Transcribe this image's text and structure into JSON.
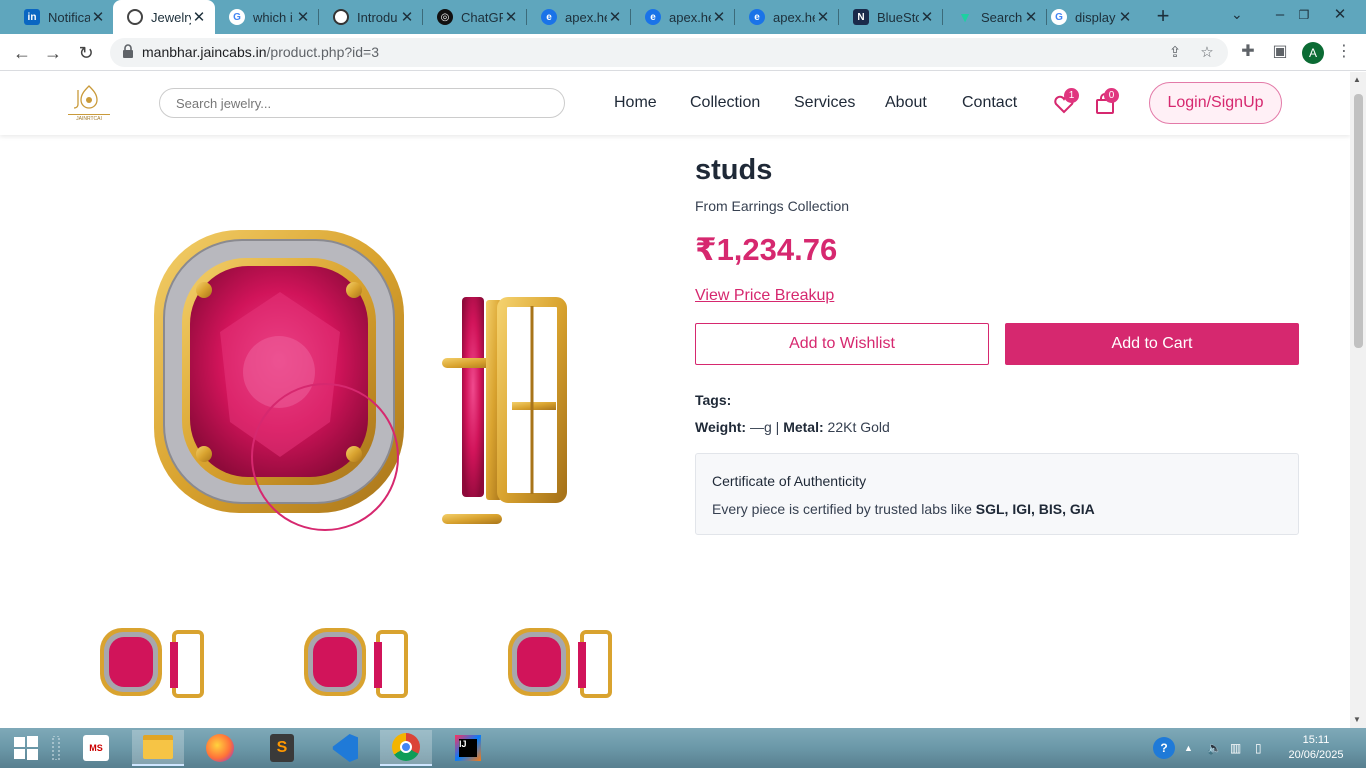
{
  "browser": {
    "tabs": [
      {
        "label": "Notifica",
        "icon": "linkedin-icon"
      },
      {
        "label": "Jewelry",
        "icon": "globe-icon",
        "active": true
      },
      {
        "label": "which i",
        "icon": "google-icon"
      },
      {
        "label": "Introdu",
        "icon": "openai-icon"
      },
      {
        "label": "ChatGP",
        "icon": "openai-icon"
      },
      {
        "label": "apex.he",
        "icon": "edge-icon"
      },
      {
        "label": "apex.he",
        "icon": "edge-icon"
      },
      {
        "label": "apex.he",
        "icon": "edge-icon"
      },
      {
        "label": "BlueSto",
        "icon": "bluestone-icon"
      },
      {
        "label": "Search",
        "icon": "search-engine-icon"
      },
      {
        "label": "display",
        "icon": "google-icon"
      }
    ],
    "url_host": "manbhar.jaincabs.in",
    "url_path": "/product.php?id=3",
    "profile_initial": "A"
  },
  "site": {
    "search_placeholder": "Search jewelry...",
    "nav": [
      "Home",
      "Collection",
      "Services",
      "About",
      "Contact"
    ],
    "wishlist_count": "1",
    "cart_count": "0",
    "login_label": "Login/SignUp",
    "logo_text": "JAINRTCAI"
  },
  "product": {
    "title": "studs",
    "collection": "From Earrings Collection",
    "price": "₹1,234.76",
    "price_breakup_label": "View Price Breakup",
    "wishlist_button": "Add to Wishlist",
    "cart_button": "Add to Cart",
    "tags_label": "Tags:",
    "weight_label": "Weight:",
    "weight_value": "—g",
    "separator": "|",
    "metal_label": "Metal:",
    "metal_value": "22Kt Gold",
    "certificate": {
      "heading": "Certificate of Authenticity",
      "text": "Every piece is certified by trusted labs like",
      "labs": "SGL, IGI, BIS, GIA"
    }
  },
  "colors": {
    "accent": "#d6286f",
    "gem": "#d1145a",
    "gold": "#d9a32f",
    "tabstrip": "#5fa6bd"
  },
  "taskbar": {
    "apps": [
      "windows-start-icon",
      "task-view-icon",
      "ms-todo-icon",
      "file-explorer-icon",
      "firefox-icon",
      "sublime-text-icon",
      "vscode-icon",
      "chrome-icon",
      "intellij-icon"
    ],
    "time": "15:11",
    "date": "20/06/2025"
  }
}
